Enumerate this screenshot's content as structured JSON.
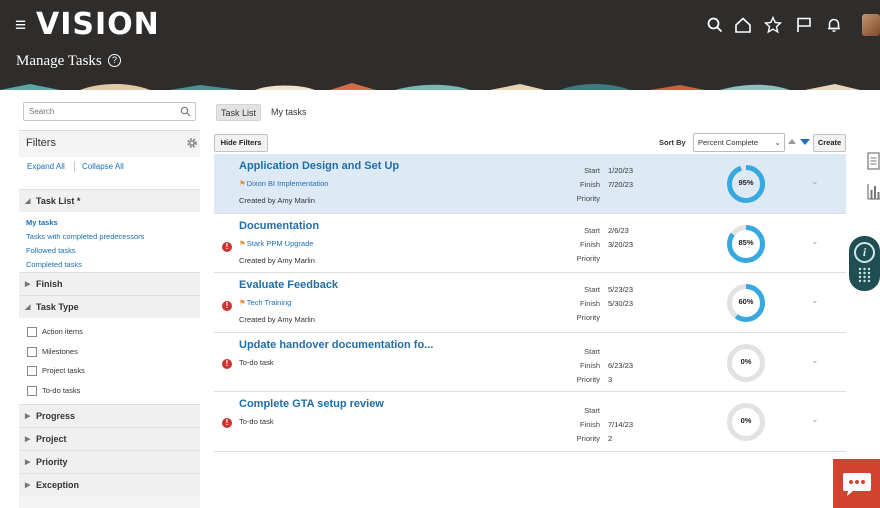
{
  "header": {
    "logo": "VISION",
    "page_title": "Manage Tasks",
    "help_glyph": "?",
    "icons": [
      "search-icon",
      "home-icon",
      "favorites-star-icon",
      "flag-icon",
      "notifications-bell-icon",
      "user-avatar"
    ]
  },
  "sidebar": {
    "search_placeholder": "Search",
    "filters_title": "Filters",
    "expand_all": "Expand All",
    "collapse_all": "Collapse All",
    "task_list_header": "Task List *",
    "task_list_items": [
      "My tasks",
      "Tasks with completed predecessors",
      "Followed tasks",
      "Completed tasks"
    ],
    "finish_header": "Finish",
    "task_type_header": "Task Type",
    "task_type_options": [
      "Action items",
      "Milestones",
      "Project tasks",
      "To-do tasks"
    ],
    "progress_header": "Progress",
    "project_header": "Project",
    "priority_header": "Priority",
    "exception_header": "Exception"
  },
  "tabs": {
    "task_list": "Task List",
    "my_tasks": "My tasks"
  },
  "toolbar": {
    "hide_filters": "Hide Filters",
    "sort_by_label": "Sort By",
    "sort_value": "Percent Complete",
    "create": "Create"
  },
  "labels": {
    "start": "Start",
    "finish": "Finish",
    "priority": "Priority",
    "created_by": "Created by"
  },
  "tasks": [
    {
      "name": "Application Design and Set Up",
      "project": "Dixon BI Implementation",
      "created_by": "Amy Marlin",
      "start": "1/20/23",
      "finish": "7/20/23",
      "priority": "",
      "percent": 95,
      "percent_label": "95%"
    },
    {
      "name": "Documentation",
      "project": "Stark PPM Upgrade",
      "created_by": "Amy Marlin",
      "start": "2/6/23",
      "finish": "3/20/23",
      "priority": "",
      "percent": 85,
      "percent_label": "85%"
    },
    {
      "name": "Evaluate Feedback",
      "project": "Tech Training",
      "created_by": "Amy Marlin",
      "start": "5/23/23",
      "finish": "5/30/23",
      "priority": "",
      "percent": 60,
      "percent_label": "60%"
    },
    {
      "name": "Update handover documentation fo...",
      "type": "To-do task",
      "start": "",
      "finish": "6/23/23",
      "priority": "3",
      "percent": 0,
      "percent_label": "0%"
    },
    {
      "name": "Complete GTA setup review",
      "type": "To-do task",
      "start": "",
      "finish": "7/14/23",
      "priority": "2",
      "percent": 0,
      "percent_label": "0%"
    }
  ],
  "colors": {
    "accent": "#1e6fb3",
    "progress": "#38a9e0",
    "track": "#e2e2e2",
    "header_bg": "#2f2d2b",
    "selected_row": "#dde9f5",
    "alert": "#cc3333",
    "chat": "#d3412f"
  }
}
